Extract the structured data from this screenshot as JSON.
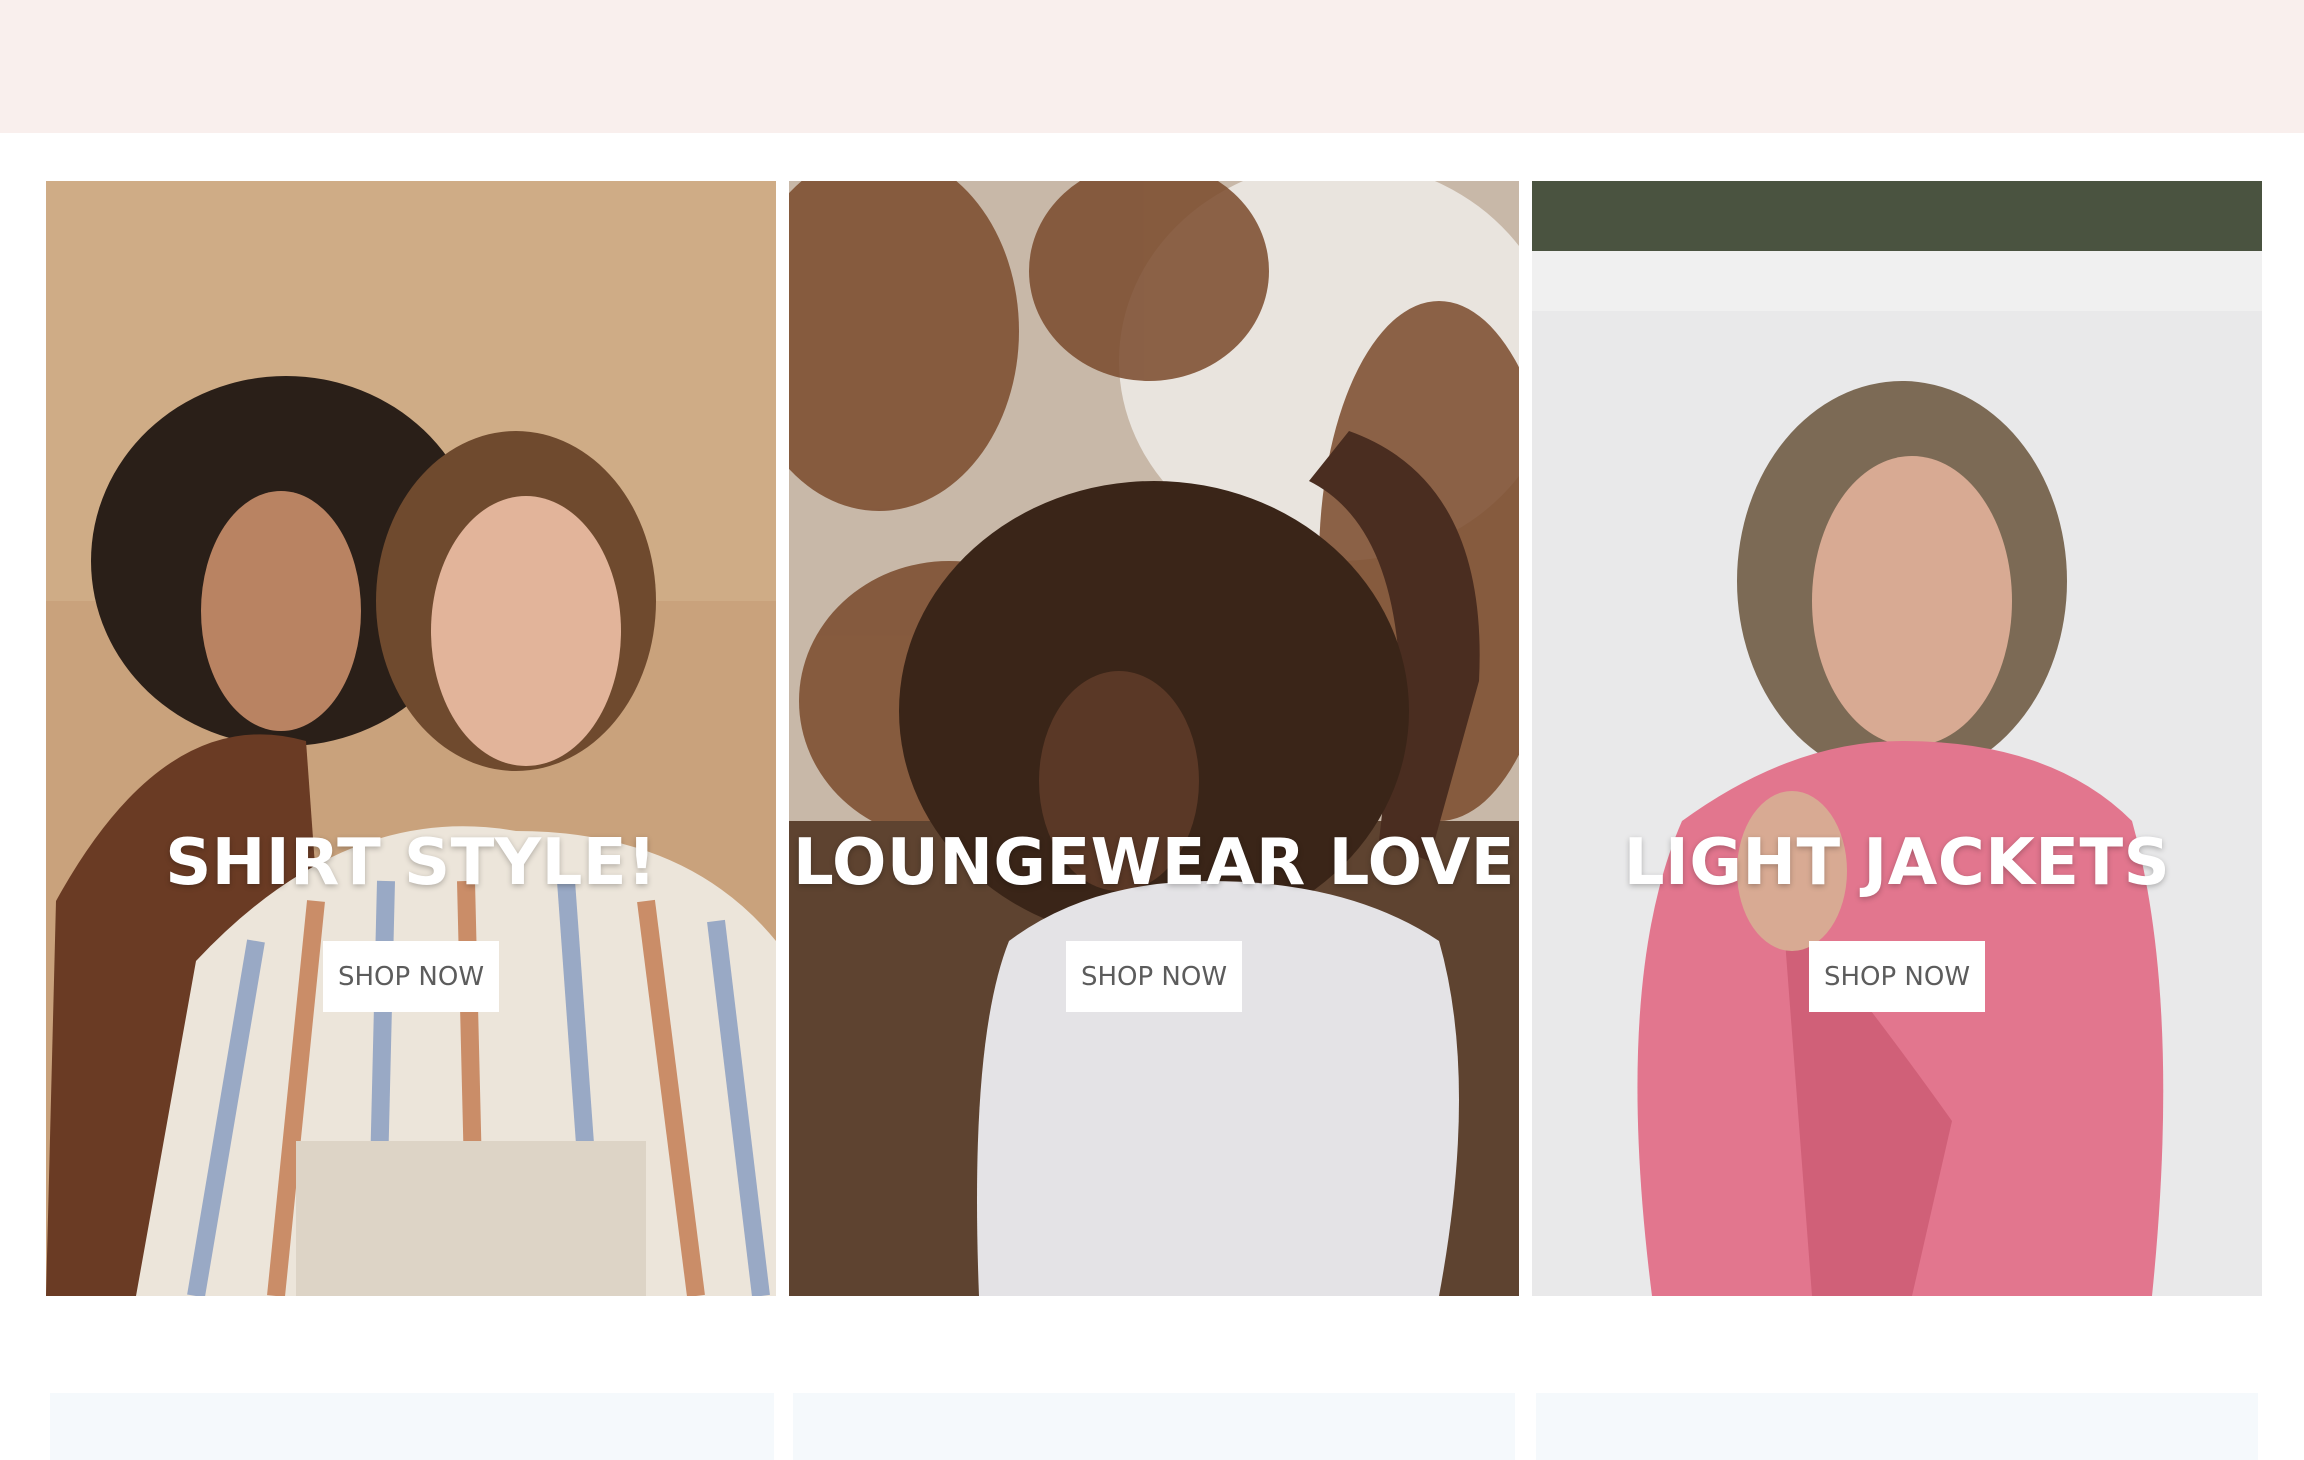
{
  "promo_cards": [
    {
      "title": "SHIRT STYLE!",
      "button_label": "SHOP NOW"
    },
    {
      "title": "LOUNGEWEAR LOVE",
      "button_label": "SHOP NOW"
    },
    {
      "title": "LIGHT JACKETS",
      "button_label": "SHOP NOW"
    }
  ],
  "colors": {
    "header_band": "#f9efed",
    "button_bg": "#ffffff",
    "button_text": "#5c5c5c",
    "lower_tiles": "#f5f9fc"
  }
}
